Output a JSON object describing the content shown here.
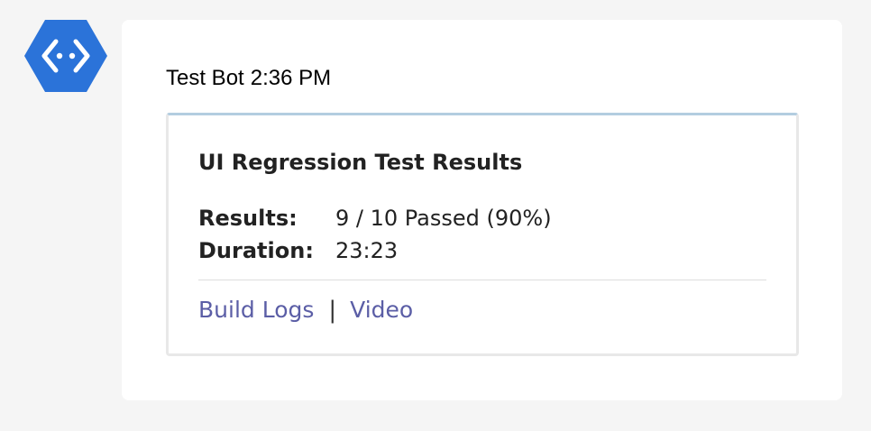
{
  "sender": {
    "name": "Test Bot",
    "time": "2:36 PM",
    "avatar_icon": "azure-devops-bot-icon",
    "avatar_color": "#2b73d9"
  },
  "card": {
    "title": "UI Regression Test Results",
    "facts": [
      {
        "key": "Results:",
        "value": "9 / 10 Passed (90%)"
      },
      {
        "key": "Duration:",
        "value": "23:23"
      }
    ],
    "actions": [
      {
        "label": "Build Logs"
      },
      {
        "label": "Video"
      }
    ],
    "separator": "|",
    "accent_color": "#b3cde0",
    "link_color": "#5b5ea6"
  }
}
